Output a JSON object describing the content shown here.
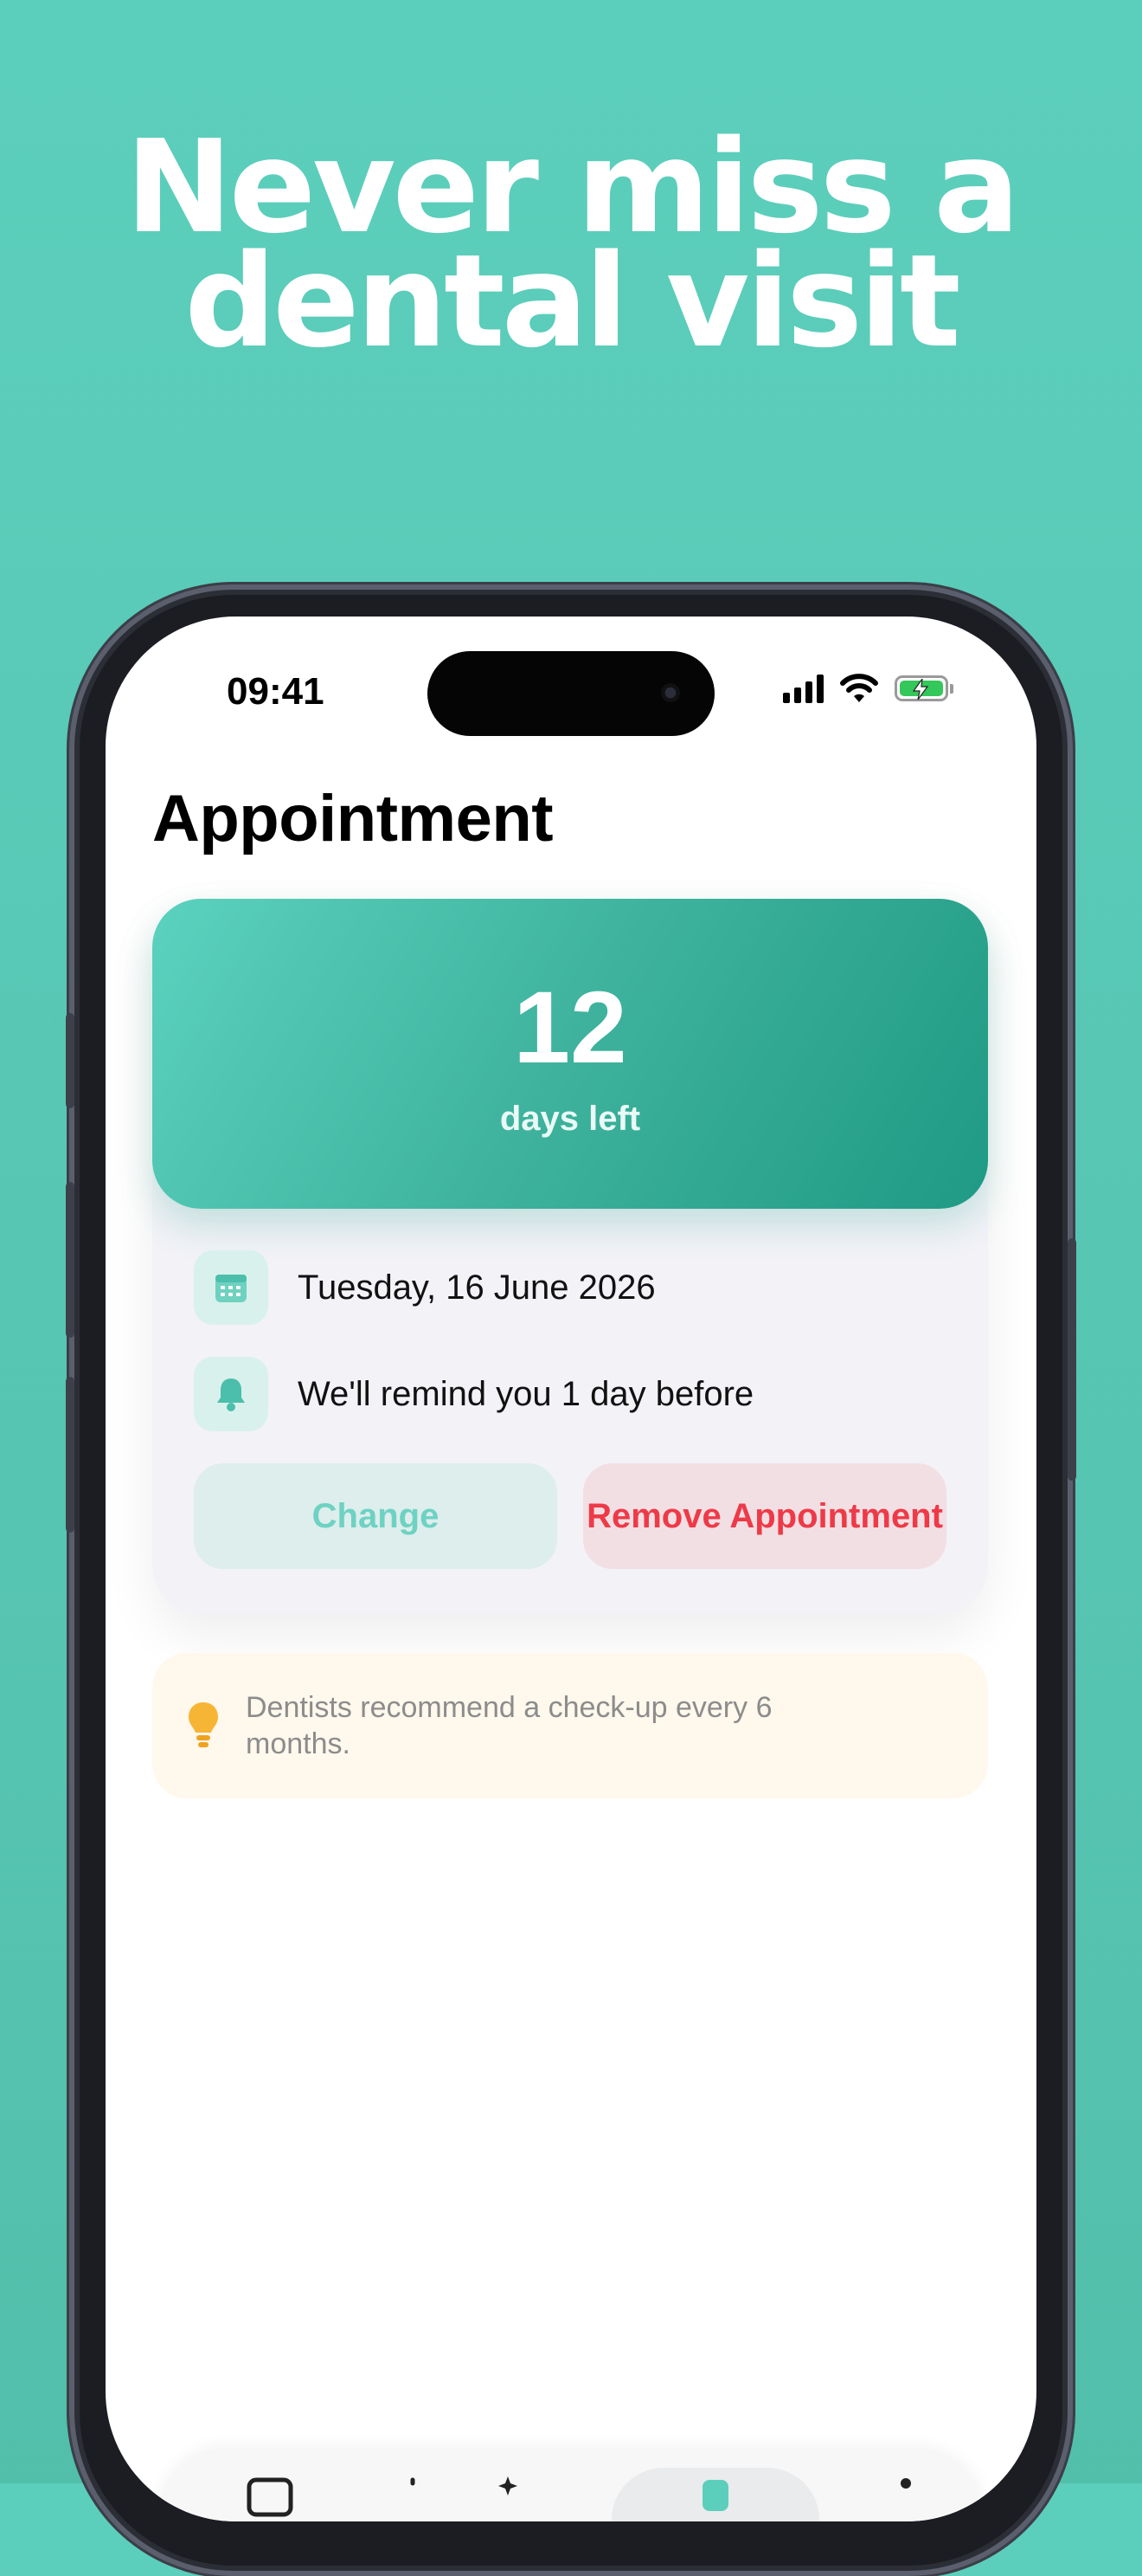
{
  "headline": {
    "line1": "Never miss a",
    "line2": "dental visit"
  },
  "status_bar": {
    "time": "09:41"
  },
  "screen": {
    "title": "Appointment",
    "countdown": {
      "number": "12",
      "label": "days left"
    },
    "date_row": {
      "icon": "calendar-icon",
      "text": "Tuesday, 16 June 2026"
    },
    "reminder_row": {
      "icon": "bell-icon",
      "text": "We'll remind you 1 day before"
    },
    "actions": {
      "change_label": "Change",
      "remove_label": "Remove Appointment"
    },
    "tip": {
      "icon": "lightbulb-icon",
      "text": "Dentists recommend a check-up every 6 months."
    }
  },
  "colors": {
    "background": "#5ccfbc",
    "accent": "#3eb29c",
    "change_text": "#6ed2c2",
    "remove_text": "#ee3a48",
    "tip_background": "#fff8ec"
  }
}
